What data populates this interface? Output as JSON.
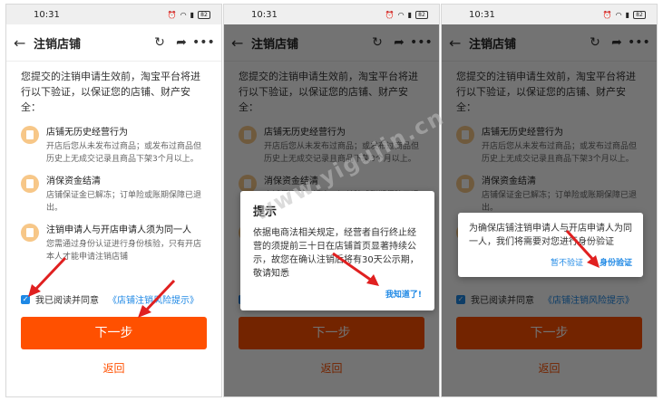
{
  "status": {
    "time": "10:31",
    "battery": "82"
  },
  "nav": {
    "title": "注销店铺"
  },
  "intro": "您提交的注销申请生效前，淘宝平台将进行以下验证，以保证您的店铺、财产安全：",
  "items": [
    {
      "title": "店铺无历史经营行为",
      "desc": "开店后您从未发布过商品；或发布过商品但历史上无成交记录且商品下架3个月以上。"
    },
    {
      "title": "消保资金结清",
      "desc": "店铺保证金已解冻；订单险或账期保障已退出。"
    },
    {
      "title": "注销申请人与开店申请人须为同一人",
      "desc": "您需通过身份认证进行身份核验，只有开店本人才能申请注销店铺"
    }
  ],
  "agreement": {
    "label": "我已阅读并同意",
    "link": "《店铺注销风险提示》"
  },
  "buttons": {
    "next": "下一步",
    "back": "返回"
  },
  "dialog1": {
    "title": "提示",
    "message": "依据电商法相关规定，经营者自行终止经营的须提前三十日在店铺首页显著持续公示，故您在确认注销后将有30天公示期，敬请知悉",
    "ok": "我知道了!"
  },
  "dialog2": {
    "message": "为确保店铺注销申请人与开店申请人为同一人，我们将需要对您进行身份验证",
    "cancel": "暂不验证",
    "confirm": "身份验证"
  },
  "watermark": "www.yigujin.cn",
  "colors": {
    "accent": "#ff5000",
    "link": "#1e88e5",
    "icon": "#f7c788",
    "arrow": "#e02020"
  }
}
